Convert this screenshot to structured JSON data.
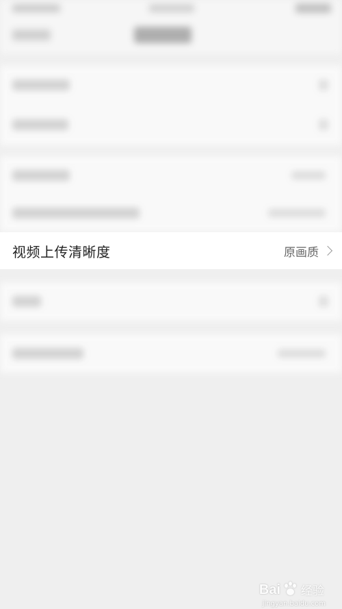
{
  "highlighted_setting": {
    "label": "视频上传清晰度",
    "value": "原画质",
    "chevron_icon": "chevron-right-icon"
  },
  "watermark": {
    "brand": "Bai",
    "sub": "经验",
    "url": "jingyan.baidu.com",
    "icon": "paw-icon"
  },
  "colors": {
    "background": "#efefef",
    "row_background": "#ffffff",
    "label_text": "#222222",
    "value_text": "#666666"
  }
}
